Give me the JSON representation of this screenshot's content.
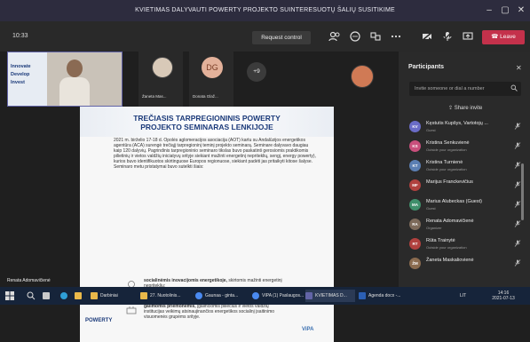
{
  "window": {
    "title": "KVIETIMAS DALYVAUTI POWERTY PROJEKTO SUINTERESUOTŲ ŠALIŲ SUSITIKIME",
    "minimize": "–",
    "maximize": "▢",
    "close": "✕"
  },
  "toolbar": {
    "clock": "10:33",
    "request_control": "Request control",
    "leave": "Leave"
  },
  "participants_strip": {
    "tile1_logo_lines": [
      "Innovate",
      "Develop",
      "Invest"
    ],
    "tile2_name": "Žaneta Mas...",
    "tile3_initials": "DG",
    "tile3_name": "Donata Glaž...",
    "overflow_count": "+9"
  },
  "slide": {
    "title_line1": "TREČIASIS TARPREGIONINIS POWERTY",
    "title_line2": "PROJEKTO SEMINARAS LENKIJOJE",
    "body": "2021 m. birželio 17-18 d. Opolės aglomeracijos asociacija (AOT) kartu su Andalūzijos energetikos agentūra (ACA) surengė trečiąjį tarpregioninį teminį projekto seminarą. Seminare dalyvavo daugiau kaip 120 dalyvių. Pagrindinis tarpregioninio seminaro tikslas buvo paskatinti gerosiomis praktikomis pilietinių ir vietos valdžių iniciatyvų srityje siekiant mažinti energetinį nepriteklių, sengį, energy powerty), kurios buvo identifikuotos skirtinguose Europos regionuose, siekiant padėti jas pritaikyti kitose šalyse. Seminaro metu pristatymai buvo sutelkti šiais:",
    "bullet1_bold": "socialinėmis inovacijomis energetikoje,",
    "bullet1_rest": "skirtomis mažinti energetinį nepritekliu;",
    "bullet2_bold": "galimomis priemonėmis,",
    "bullet2_rest": "įgalinčiomis piliečius ir vietos valdžių institucijas veikimų atsinaujinančios energetikos socialinį įsaitinimo visuomenės grupėms srityje.",
    "logo": "POWERTY",
    "vipa": "ViPA"
  },
  "presenter_label": "Renata Adomavičienė",
  "panel": {
    "title": "Participants",
    "close": "✕",
    "invite_placeholder": "Invite someone or dial a number",
    "share_invite": "Share invite",
    "people": [
      {
        "initials": "KV",
        "name": "Kęstutis Kupšys, Vartotojų ...",
        "sub": "Guest",
        "color": "#6a6cc7"
      },
      {
        "initials": "KS",
        "name": "Kristina Senkuvienė",
        "sub": "Outside your organization",
        "color": "#c94f7c"
      },
      {
        "initials": "KT",
        "name": "Kristina Turnienė",
        "sub": "Outside your organization",
        "color": "#5b7fb3"
      },
      {
        "initials": "MF",
        "name": "Marijus Franckevičius",
        "sub": "",
        "color": "#b0413e"
      },
      {
        "initials": "MA",
        "name": "Marius Alubeckas (Guest)",
        "sub": "Guest",
        "color": "#3f8f6b"
      },
      {
        "initials": "RA",
        "name": "Renata Adomavičienė",
        "sub": "Organizer",
        "color": "#7d6a5a"
      },
      {
        "initials": "RT",
        "name": "Rūta Trainytė",
        "sub": "Outside your organization",
        "color": "#b0413e"
      },
      {
        "initials": "ŽM",
        "name": "Žaneta Maskaliovienė",
        "sub": "",
        "color": "#8a6b4f"
      }
    ]
  },
  "taskbar": {
    "items": [
      "Darbiniai",
      "27. Nuotolinis...",
      "Gaunaa - ginta...",
      "VIPA (1) Paslaugos...",
      "KVIETIMAS D...",
      "Agenda docx -..."
    ],
    "time": "14:16",
    "date": "2021-07-13",
    "lang": "LIT"
  },
  "colors": {
    "accent": "#6264a7",
    "leave": "#c4314b",
    "taskbar": "#16243a"
  }
}
